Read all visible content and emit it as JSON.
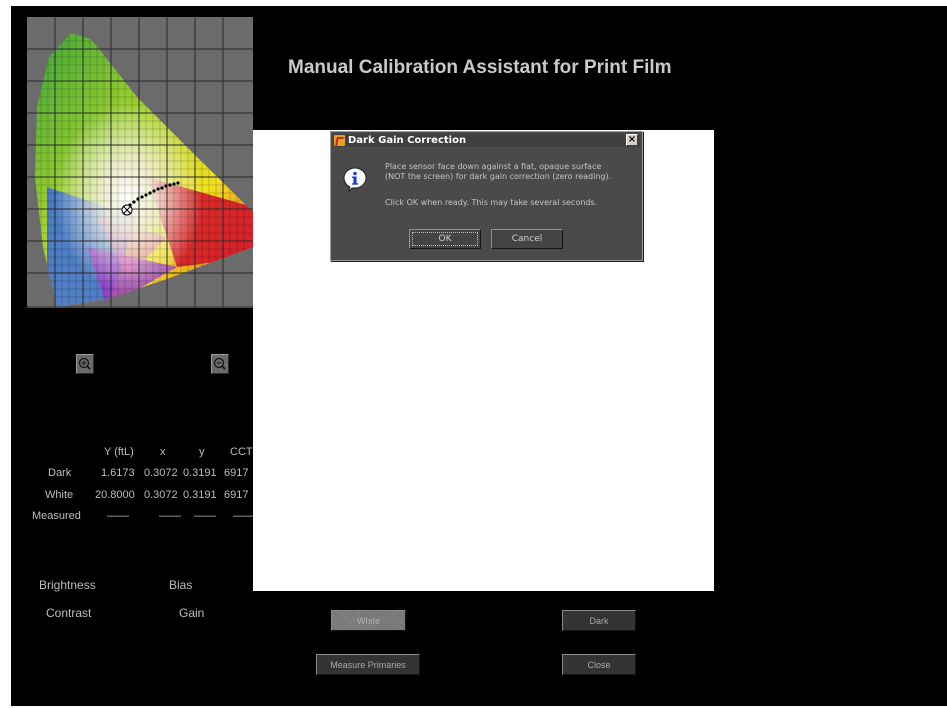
{
  "window": {
    "title": "Manual Calibration Assistant for Print Film"
  },
  "chromaticity": {
    "grid": true
  },
  "zoom": {
    "zoom_in": "zoom-in-icon",
    "zoom_out": "zoom-out-icon"
  },
  "measurements": {
    "columns": [
      "Y (ftL)",
      "x",
      "y",
      "CCT"
    ],
    "rows": [
      {
        "label": "Dark",
        "values": [
          "1.6173",
          "0.3072",
          "0.3191",
          "6917"
        ]
      },
      {
        "label": "White",
        "values": [
          "20.8000",
          "0.3072",
          "0.3191",
          "6917"
        ]
      },
      {
        "label": "Measured",
        "values": [
          "——",
          "——",
          "——",
          "——"
        ]
      }
    ]
  },
  "adjustments": {
    "brightness": "Brightness",
    "bias": "Bias",
    "contrast": "Contrast",
    "gain": "Gain"
  },
  "buttons": {
    "white": "White",
    "dark": "Dark",
    "measure_primaries": "Measure Primaries",
    "close": "Close"
  },
  "dialog": {
    "title": "Dark Gain Correction",
    "close_glyph": "×",
    "line1": "Place sensor face down against a flat, opaque surface",
    "line2": "(NOT the screen) for dark gain correction (zero reading).",
    "line3": "Click OK when ready.  This may take several seconds.",
    "ok": "OK",
    "cancel": "Cancel",
    "icon": "info-icon"
  },
  "colors": {
    "background": "#000000",
    "text": "#bdbdbd",
    "dialog_bg": "#4a4a4a",
    "panel": "#ffffff"
  }
}
